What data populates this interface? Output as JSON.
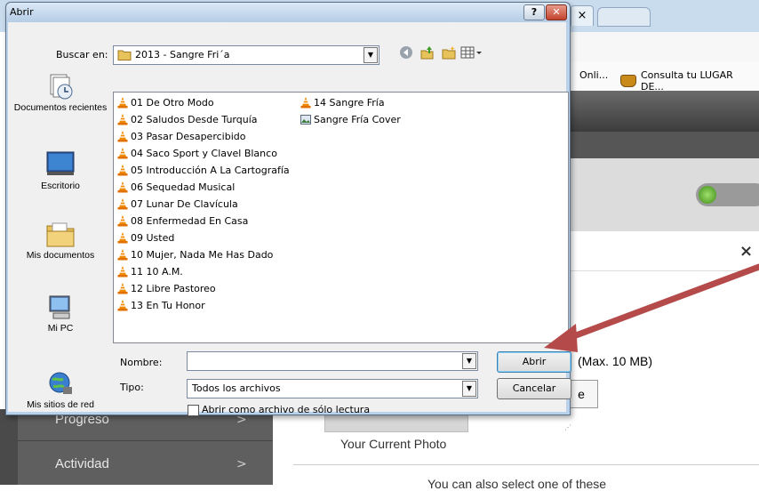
{
  "dialog": {
    "title": "Abrir",
    "help_label": "?",
    "close_label": "✕",
    "lookin_label": "Buscar en:",
    "lookin_value": "2013 - Sangre Fri´a",
    "places": [
      {
        "label": "Documentos recientes",
        "icon": "recent-documents-icon"
      },
      {
        "label": "Escritorio",
        "icon": "desktop-icon"
      },
      {
        "label": "Mis documentos",
        "icon": "my-documents-icon"
      },
      {
        "label": "Mi PC",
        "icon": "my-computer-icon"
      },
      {
        "label": "Mis sitios de red",
        "icon": "network-places-icon"
      }
    ],
    "files": [
      {
        "name": "01 De Otro Modo",
        "icon": "vlc-icon"
      },
      {
        "name": "02 Saludos Desde Turquía",
        "icon": "vlc-icon"
      },
      {
        "name": "03 Pasar Desapercibido",
        "icon": "vlc-icon"
      },
      {
        "name": "04 Saco Sport y Clavel Blanco",
        "icon": "vlc-icon"
      },
      {
        "name": "05 Introducción A La Cartografía",
        "icon": "vlc-icon"
      },
      {
        "name": "06 Sequedad Musical",
        "icon": "vlc-icon"
      },
      {
        "name": "07 Lunar De Clavícula",
        "icon": "vlc-icon"
      },
      {
        "name": "08 Enfermedad En Casa",
        "icon": "vlc-icon"
      },
      {
        "name": "09 Usted",
        "icon": "vlc-icon"
      },
      {
        "name": "10 Mujer, Nada Me Has Dado",
        "icon": "vlc-icon"
      },
      {
        "name": "11 10 A.M.",
        "icon": "vlc-icon"
      },
      {
        "name": "12 Libre Pastoreo",
        "icon": "vlc-icon"
      },
      {
        "name": "13 En Tu Honor",
        "icon": "vlc-icon"
      },
      {
        "name": "14 Sangre Fría",
        "icon": "vlc-icon"
      },
      {
        "name": "Sangre Fría Cover",
        "icon": "image-file-icon"
      }
    ],
    "filename_label": "Nombre:",
    "filename_value": "",
    "filetype_label": "Tipo:",
    "filetype_value": "Todos los archivos",
    "open_button": "Abrir",
    "cancel_button": "Cancelar",
    "readonly_label": "Abrir como archivo de sólo lectura",
    "readonly_checked": false
  },
  "background": {
    "tab_close": "×",
    "bookmarks": [
      "Onli...",
      "Consulta tu LUGAR DE..."
    ],
    "modal_close": "×",
    "max_size": "(Max. 10 MB)",
    "button_partial": "e",
    "photo_caption": "Your Current Photo",
    "also_select": "You can also select one of these",
    "menu": [
      {
        "label": "Progreso",
        "chevron": ">"
      },
      {
        "label": "Actividad",
        "chevron": ">"
      }
    ],
    "arrow_color": "#b54a4a"
  }
}
